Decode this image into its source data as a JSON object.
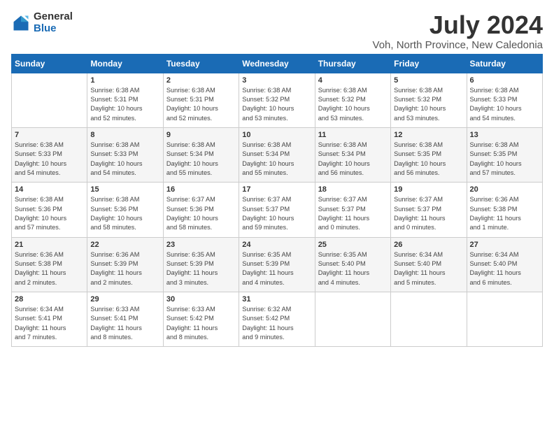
{
  "logo": {
    "general": "General",
    "blue": "Blue"
  },
  "title": "July 2024",
  "location": "Voh, North Province, New Caledonia",
  "days_of_week": [
    "Sunday",
    "Monday",
    "Tuesday",
    "Wednesday",
    "Thursday",
    "Friday",
    "Saturday"
  ],
  "weeks": [
    [
      {
        "day": "",
        "info": ""
      },
      {
        "day": "1",
        "info": "Sunrise: 6:38 AM\nSunset: 5:31 PM\nDaylight: 10 hours\nand 52 minutes."
      },
      {
        "day": "2",
        "info": "Sunrise: 6:38 AM\nSunset: 5:31 PM\nDaylight: 10 hours\nand 52 minutes."
      },
      {
        "day": "3",
        "info": "Sunrise: 6:38 AM\nSunset: 5:32 PM\nDaylight: 10 hours\nand 53 minutes."
      },
      {
        "day": "4",
        "info": "Sunrise: 6:38 AM\nSunset: 5:32 PM\nDaylight: 10 hours\nand 53 minutes."
      },
      {
        "day": "5",
        "info": "Sunrise: 6:38 AM\nSunset: 5:32 PM\nDaylight: 10 hours\nand 53 minutes."
      },
      {
        "day": "6",
        "info": "Sunrise: 6:38 AM\nSunset: 5:33 PM\nDaylight: 10 hours\nand 54 minutes."
      }
    ],
    [
      {
        "day": "7",
        "info": "Sunrise: 6:38 AM\nSunset: 5:33 PM\nDaylight: 10 hours\nand 54 minutes."
      },
      {
        "day": "8",
        "info": "Sunrise: 6:38 AM\nSunset: 5:33 PM\nDaylight: 10 hours\nand 54 minutes."
      },
      {
        "day": "9",
        "info": "Sunrise: 6:38 AM\nSunset: 5:34 PM\nDaylight: 10 hours\nand 55 minutes."
      },
      {
        "day": "10",
        "info": "Sunrise: 6:38 AM\nSunset: 5:34 PM\nDaylight: 10 hours\nand 55 minutes."
      },
      {
        "day": "11",
        "info": "Sunrise: 6:38 AM\nSunset: 5:34 PM\nDaylight: 10 hours\nand 56 minutes."
      },
      {
        "day": "12",
        "info": "Sunrise: 6:38 AM\nSunset: 5:35 PM\nDaylight: 10 hours\nand 56 minutes."
      },
      {
        "day": "13",
        "info": "Sunrise: 6:38 AM\nSunset: 5:35 PM\nDaylight: 10 hours\nand 57 minutes."
      }
    ],
    [
      {
        "day": "14",
        "info": "Sunrise: 6:38 AM\nSunset: 5:36 PM\nDaylight: 10 hours\nand 57 minutes."
      },
      {
        "day": "15",
        "info": "Sunrise: 6:38 AM\nSunset: 5:36 PM\nDaylight: 10 hours\nand 58 minutes."
      },
      {
        "day": "16",
        "info": "Sunrise: 6:37 AM\nSunset: 5:36 PM\nDaylight: 10 hours\nand 58 minutes."
      },
      {
        "day": "17",
        "info": "Sunrise: 6:37 AM\nSunset: 5:37 PM\nDaylight: 10 hours\nand 59 minutes."
      },
      {
        "day": "18",
        "info": "Sunrise: 6:37 AM\nSunset: 5:37 PM\nDaylight: 11 hours\nand 0 minutes."
      },
      {
        "day": "19",
        "info": "Sunrise: 6:37 AM\nSunset: 5:37 PM\nDaylight: 11 hours\nand 0 minutes."
      },
      {
        "day": "20",
        "info": "Sunrise: 6:36 AM\nSunset: 5:38 PM\nDaylight: 11 hours\nand 1 minute."
      }
    ],
    [
      {
        "day": "21",
        "info": "Sunrise: 6:36 AM\nSunset: 5:38 PM\nDaylight: 11 hours\nand 2 minutes."
      },
      {
        "day": "22",
        "info": "Sunrise: 6:36 AM\nSunset: 5:39 PM\nDaylight: 11 hours\nand 2 minutes."
      },
      {
        "day": "23",
        "info": "Sunrise: 6:35 AM\nSunset: 5:39 PM\nDaylight: 11 hours\nand 3 minutes."
      },
      {
        "day": "24",
        "info": "Sunrise: 6:35 AM\nSunset: 5:39 PM\nDaylight: 11 hours\nand 4 minutes."
      },
      {
        "day": "25",
        "info": "Sunrise: 6:35 AM\nSunset: 5:40 PM\nDaylight: 11 hours\nand 4 minutes."
      },
      {
        "day": "26",
        "info": "Sunrise: 6:34 AM\nSunset: 5:40 PM\nDaylight: 11 hours\nand 5 minutes."
      },
      {
        "day": "27",
        "info": "Sunrise: 6:34 AM\nSunset: 5:40 PM\nDaylight: 11 hours\nand 6 minutes."
      }
    ],
    [
      {
        "day": "28",
        "info": "Sunrise: 6:34 AM\nSunset: 5:41 PM\nDaylight: 11 hours\nand 7 minutes."
      },
      {
        "day": "29",
        "info": "Sunrise: 6:33 AM\nSunset: 5:41 PM\nDaylight: 11 hours\nand 8 minutes."
      },
      {
        "day": "30",
        "info": "Sunrise: 6:33 AM\nSunset: 5:42 PM\nDaylight: 11 hours\nand 8 minutes."
      },
      {
        "day": "31",
        "info": "Sunrise: 6:32 AM\nSunset: 5:42 PM\nDaylight: 11 hours\nand 9 minutes."
      },
      {
        "day": "",
        "info": ""
      },
      {
        "day": "",
        "info": ""
      },
      {
        "day": "",
        "info": ""
      }
    ]
  ]
}
